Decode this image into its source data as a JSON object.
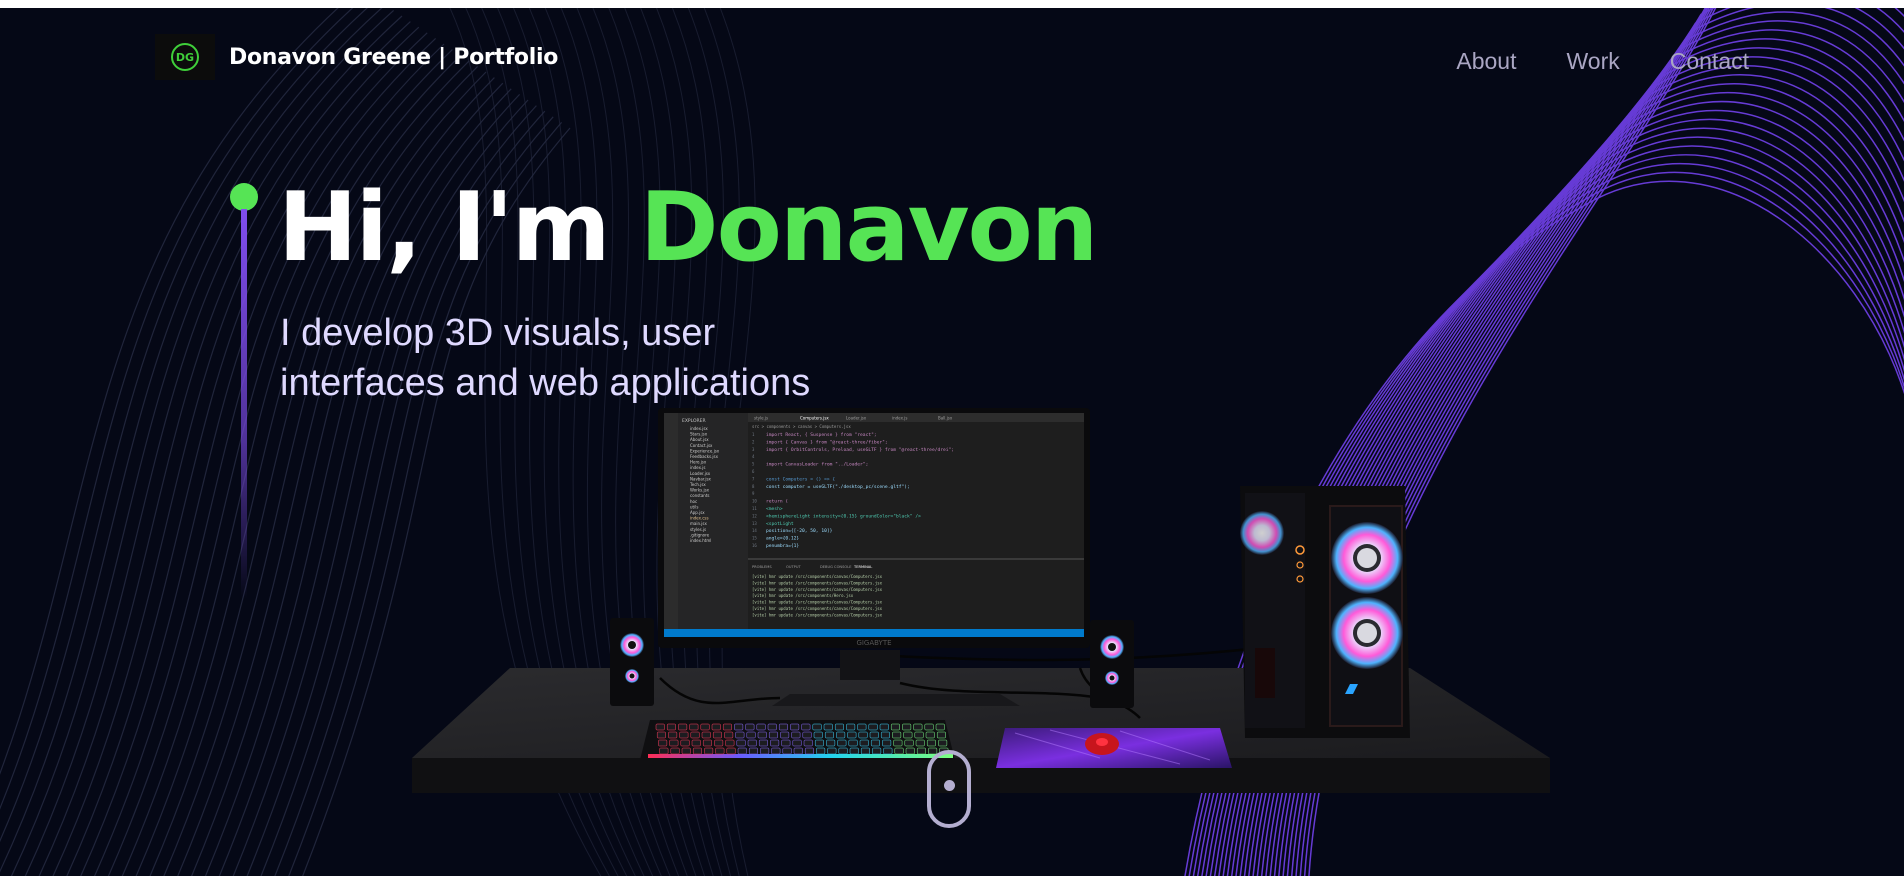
{
  "nav": {
    "logo_initials": "DG",
    "brand": "Donavon Greene",
    "brand_suffix": " | Portfolio",
    "links": [
      {
        "label": "About"
      },
      {
        "label": "Work"
      },
      {
        "label": "Contact"
      }
    ]
  },
  "hero": {
    "greeting": "Hi, I'm ",
    "name": "Donavon",
    "subtitle_line1": "I develop 3D visuals, user",
    "subtitle_line2": "interfaces and web applications"
  },
  "scene": {
    "monitor_brand": "GIGABYTE",
    "editor": {
      "tabs": [
        "style.js",
        "Computers.jsx",
        "Loader.jsx",
        "index.js",
        "Ball.jsx"
      ],
      "breadcrumb": "src > components > canvas > Computers.jsx",
      "code_lines": [
        "import React, { Suspense } from \"react\";",
        "import { Canvas } from \"@react-three/fiber\";",
        "import { OrbitControls, Preload, useGLTF } from \"@react-three/drei\";",
        "",
        "import CanvasLoader from \"../Loader\";",
        "",
        "const Computers = () => {",
        "  const computer = useGLTF(\"./desktop_pc/scene.gltf\");",
        "",
        "  return (",
        "    <mesh>",
        "      <hemisphereLight intensity={0.15} groundColor=\"black\" />",
        "      <spotLight",
        "        position={[-20, 50, 10]}",
        "        angle={0.12}",
        "        penumbra={1}"
      ],
      "explorer_title": "EXPLORER",
      "files": [
        "index.jsx",
        "Stars.jsx",
        "About.jsx",
        "Contact.jsx",
        "Experience.jsx",
        "Feedbacks.jsx",
        "Hero.jsx",
        "index.js",
        "Loader.jsx",
        "Navbar.jsx",
        "Tech.jsx",
        "Works.jsx",
        "constants",
        "hoc",
        "utils",
        "App.jsx",
        "index.css",
        "main.jsx",
        "styles.js",
        ".gitignore",
        "index.html"
      ],
      "panel_tabs": [
        "PROBLEMS",
        "OUTPUT",
        "DEBUG CONSOLE",
        "TERMINAL"
      ],
      "terminal_lines": [
        "[vite] hmr update /src/components/canvas/Computers.jsx",
        "[vite] hmr update /src/components/canvas/Computers.jsx",
        "[vite] hmr update /src/components/canvas/Computers.jsx",
        "[vite] hmr update /src/components/Hero.jsx",
        "[vite] hmr update /src/components/canvas/Computers.jsx",
        "[vite] hmr update /src/components/canvas/Computers.jsx",
        "[vite] hmr update /src/components/canvas/Computers.jsx"
      ]
    }
  },
  "colors": {
    "background": "#050816",
    "accent_green": "#56e455",
    "accent_purple": "#804dee",
    "nav_text": "#aaa6c3",
    "subtitle_text": "#dfd9ff"
  }
}
